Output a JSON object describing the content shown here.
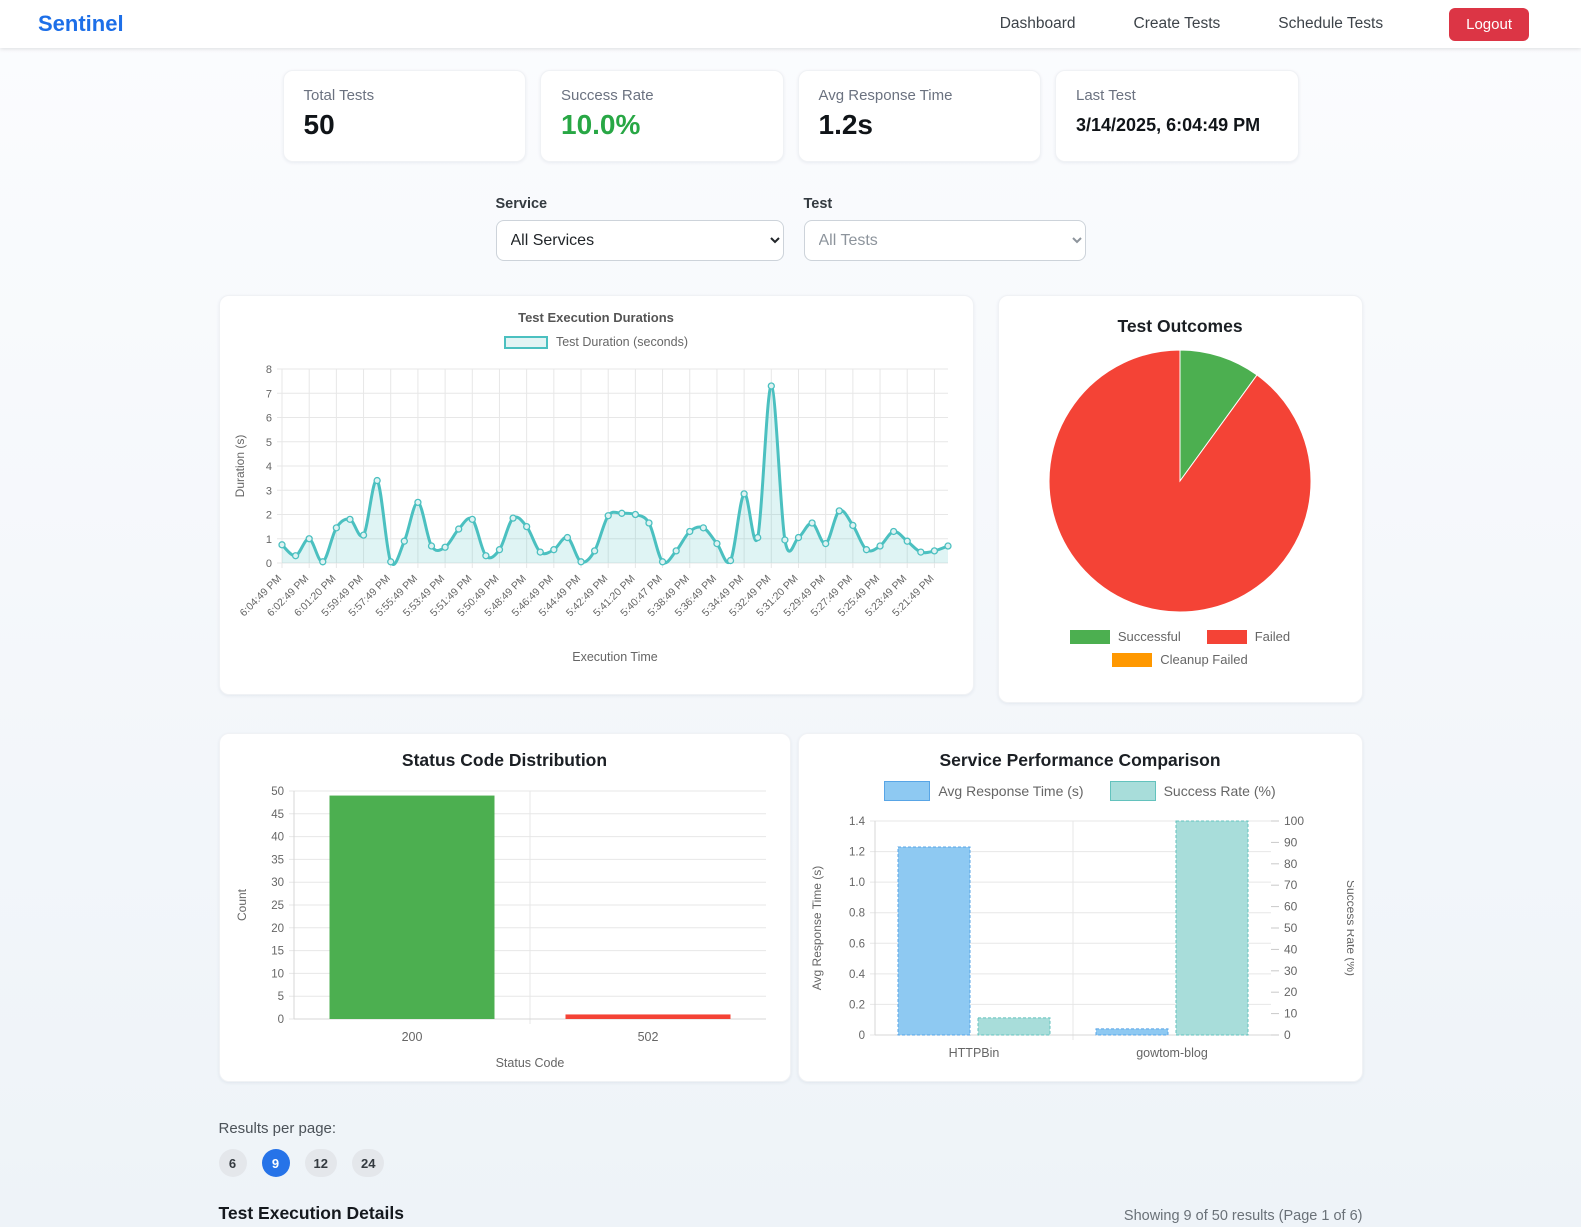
{
  "header": {
    "brand": "Sentinel",
    "nav": [
      {
        "label": "Dashboard"
      },
      {
        "label": "Create Tests"
      },
      {
        "label": "Schedule Tests"
      }
    ],
    "logout_label": "Logout"
  },
  "stats": [
    {
      "label": "Total Tests",
      "value": "50"
    },
    {
      "label": "Success Rate",
      "value": "10.0%"
    },
    {
      "label": "Avg Response Time",
      "value": "1.2s"
    },
    {
      "label": "Last Test",
      "value": "3/14/2025, 6:04:49 PM"
    }
  ],
  "filters": {
    "service": {
      "label": "Service",
      "selected": "All Services"
    },
    "test": {
      "label": "Test",
      "selected": "All Tests"
    }
  },
  "results_per_page": {
    "label": "Results per page:",
    "options": [
      "6",
      "9",
      "12",
      "24"
    ],
    "active": "9"
  },
  "details": {
    "title": "Test Execution Details",
    "summary": "Showing 9 of 50 results (Page 1 of 6)"
  },
  "chart_data": [
    {
      "id": "durations",
      "type": "line",
      "title": "Test Execution Durations",
      "legend": [
        "Test Duration (seconds)"
      ],
      "legend_box": {
        "fill": "#e3f4f4",
        "border": "#4bc0c0"
      },
      "xlabel": "Execution Time",
      "ylabel": "Duration (s)",
      "ylim": [
        0,
        8
      ],
      "ytick_step": 1,
      "line_color": "#4bc0c0",
      "fill_color": "rgba(75,192,192,0.18)",
      "x_tick_labels": [
        "6:04:49 PM",
        "6:02:49 PM",
        "6:01:20 PM",
        "5:59:49 PM",
        "5:57:49 PM",
        "5:55:49 PM",
        "5:53:49 PM",
        "5:51:49 PM",
        "5:50:49 PM",
        "5:48:49 PM",
        "5:46:49 PM",
        "5:44:49 PM",
        "5:42:49 PM",
        "5:41:20 PM",
        "5:40:47 PM",
        "5:38:49 PM",
        "5:36:49 PM",
        "5:34:49 PM",
        "5:32:49 PM",
        "5:31:20 PM",
        "5:29:49 PM",
        "5:27:49 PM",
        "5:25:49 PM",
        "5:23:49 PM",
        "5:21:49 PM"
      ],
      "values": [
        0.75,
        0.3,
        1.0,
        0.05,
        1.45,
        1.8,
        1.15,
        3.4,
        0.05,
        0.9,
        2.5,
        0.7,
        0.65,
        1.4,
        1.8,
        0.3,
        0.55,
        1.85,
        1.5,
        0.45,
        0.55,
        1.05,
        0.05,
        0.5,
        1.95,
        2.05,
        2.0,
        1.65,
        0.05,
        0.5,
        1.3,
        1.45,
        0.8,
        0.1,
        2.85,
        1.05,
        7.3,
        0.95,
        1.05,
        1.65,
        0.8,
        2.15,
        1.55,
        0.55,
        0.7,
        1.3,
        0.9,
        0.45,
        0.5,
        0.7
      ]
    },
    {
      "id": "outcomes",
      "type": "pie",
      "title": "Test Outcomes",
      "slices": [
        {
          "label": "Successful",
          "value": 5,
          "color": "#4caf50"
        },
        {
          "label": "Failed",
          "value": 45,
          "color": "#f44336"
        },
        {
          "label": "Cleanup Failed",
          "value": 0,
          "color": "#ff9800"
        }
      ],
      "legend_position": "bottom"
    },
    {
      "id": "status_codes",
      "type": "bar",
      "title": "Status Code Distribution",
      "categories": [
        "200",
        "502"
      ],
      "values": [
        49,
        1
      ],
      "colors": [
        "#4caf50",
        "#f44336"
      ],
      "xlabel": "Status Code",
      "ylabel": "Count",
      "ylim": [
        0,
        50
      ],
      "ytick_step": 5
    },
    {
      "id": "service_perf",
      "type": "bar-dual-axis",
      "title": "Service Performance Comparison",
      "categories": [
        "HTTPBin",
        "gowtom-blog"
      ],
      "series": [
        {
          "name": "Avg Response Time (s)",
          "axis": "left",
          "values": [
            1.23,
            0.04
          ],
          "fill": "#8ec9f2",
          "border": "#58a5e6"
        },
        {
          "name": "Success Rate (%)",
          "axis": "right",
          "values": [
            8,
            100
          ],
          "fill": "#a8ddda",
          "border": "#63c2bd"
        }
      ],
      "left_axis": {
        "label": "Avg Response Time (s)",
        "lim": [
          0,
          1.4
        ],
        "step": 0.2
      },
      "right_axis": {
        "label": "Success Rate (%)",
        "lim": [
          0,
          100
        ],
        "step": 10
      },
      "legend_position": "top"
    }
  ]
}
